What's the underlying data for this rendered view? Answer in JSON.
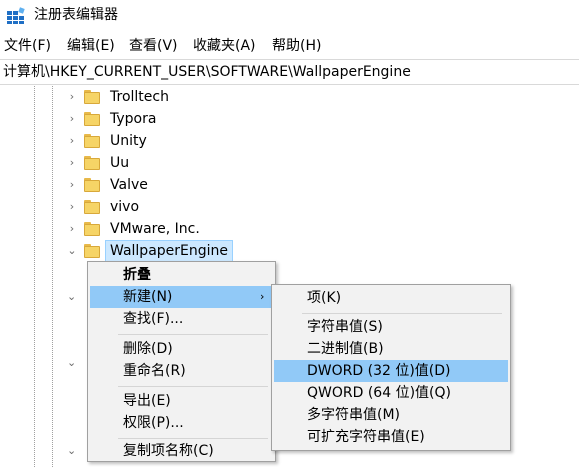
{
  "window": {
    "title": "注册表编辑器",
    "icon": "regedit-icon"
  },
  "menubar": {
    "items": [
      "文件(F)",
      "编辑(E)",
      "查看(V)",
      "收藏夹(A)",
      "帮助(H)"
    ]
  },
  "address": {
    "path": "计算机\\HKEY_CURRENT_USER\\SOFTWARE\\WallpaperEngine"
  },
  "tree": {
    "items": [
      {
        "label": "Trolltech",
        "expander": "›"
      },
      {
        "label": "Typora",
        "expander": "›"
      },
      {
        "label": "Unity",
        "expander": "›"
      },
      {
        "label": "Uu",
        "expander": "›"
      },
      {
        "label": "Valve",
        "expander": "›"
      },
      {
        "label": "vivo",
        "expander": "›"
      },
      {
        "label": "VMware, Inc.",
        "expander": "›"
      },
      {
        "label": "WallpaperEngine",
        "expander": "⌄",
        "selected": true
      }
    ]
  },
  "context_menu": {
    "items": [
      {
        "label": "折叠",
        "bold": true
      },
      {
        "label": "新建(N)",
        "highlighted": true,
        "submenu": true
      },
      {
        "label": "查找(F)..."
      },
      {
        "label": "删除(D)"
      },
      {
        "label": "重命名(R)"
      },
      {
        "label": "导出(E)"
      },
      {
        "label": "权限(P)..."
      },
      {
        "label": "复制项名称(C)"
      }
    ],
    "submenu_arrow": "›"
  },
  "new_submenu": {
    "items": [
      {
        "label": "项(K)"
      },
      {
        "label": "字符串值(S)"
      },
      {
        "label": "二进制值(B)"
      },
      {
        "label": "DWORD (32 位)值(D)",
        "highlighted": true
      },
      {
        "label": "QWORD (64 位)值(Q)"
      },
      {
        "label": "多字符串值(M)"
      },
      {
        "label": "可扩充字符串值(E)"
      }
    ]
  },
  "colors": {
    "highlight": "#91c9f7",
    "selection": "#cce8ff",
    "menu_bg": "#f2f2f2",
    "folder": "#f6d466"
  }
}
